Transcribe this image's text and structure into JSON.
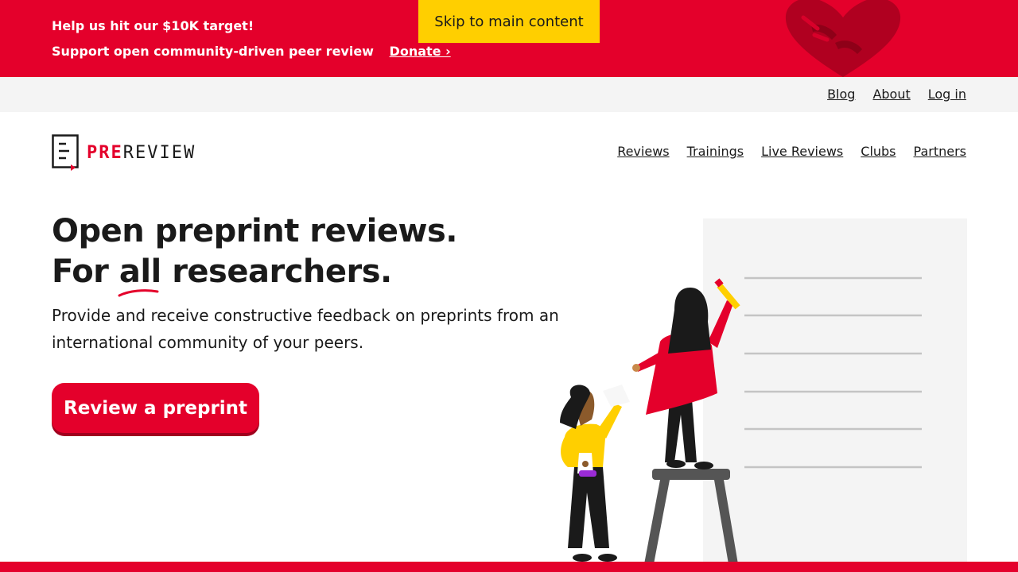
{
  "banner": {
    "line1": "Help us hit our $10K target!",
    "line2": "Support open community-driven peer review",
    "donate_label": "Donate ›"
  },
  "skip_link": "Skip to main content",
  "utility_nav": {
    "items": [
      "Blog",
      "About",
      "Log in"
    ]
  },
  "logo": {
    "pre": "PRE",
    "review": "REVIEW"
  },
  "main_nav": {
    "items": [
      "Reviews",
      "Trainings",
      "Live Reviews",
      "Clubs",
      "Partners"
    ]
  },
  "hero": {
    "title_line1": "Open preprint reviews.",
    "title_line2_prefix": "For ",
    "title_line2_emphasis": "all",
    "title_line2_suffix": " researchers.",
    "description": "Provide and receive constructive feedback on preprints from an international community of your peers.",
    "cta_label": "Review a preprint"
  },
  "colors": {
    "brand_red": "#e4002b",
    "skip_yellow": "#ffcf00",
    "utility_gray": "#f4f4f4"
  }
}
